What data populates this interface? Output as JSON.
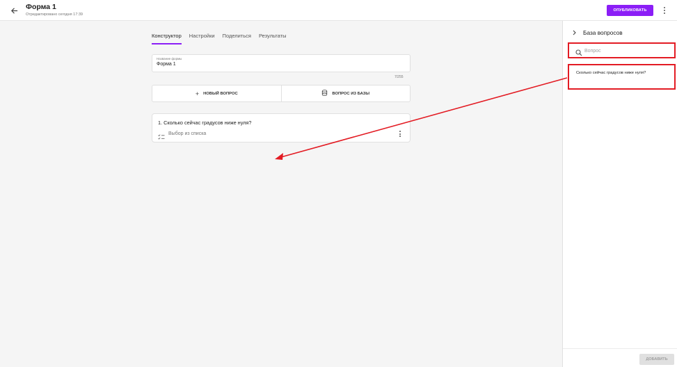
{
  "header": {
    "back_icon": "arrow-left-icon",
    "title": "Форма 1",
    "edited": "Отредактировано сегодня 17:39",
    "publish_label": "ОПУБЛИКОВАТЬ",
    "more_icon": "more-vertical-icon"
  },
  "tabs": [
    {
      "label": "Конструктор",
      "active": true
    },
    {
      "label": "Настройки",
      "active": false
    },
    {
      "label": "Поделиться",
      "active": false
    },
    {
      "label": "Результаты",
      "active": false
    }
  ],
  "form_name": {
    "label": "Название формы",
    "value": "Форма 1",
    "counter": "7/255"
  },
  "add_buttons": {
    "new_question": "НОВЫЙ ВОПРОС",
    "from_base": "ВОПРОС ИЗ БАЗЫ"
  },
  "question": {
    "text": "1. Сколько сейчас градусов ниже нуля?",
    "type": "Выбор из списка"
  },
  "panel": {
    "title": "База вопросов",
    "search_placeholder": "Вопрос",
    "items": [
      {
        "text": "Сколько сейчас градусов ниже нуля?"
      }
    ],
    "add_label": "ДОБАВИТЬ"
  },
  "colors": {
    "accent": "#8b1ef6",
    "annotation": "#e31b23",
    "background": "#f5f5f5"
  }
}
